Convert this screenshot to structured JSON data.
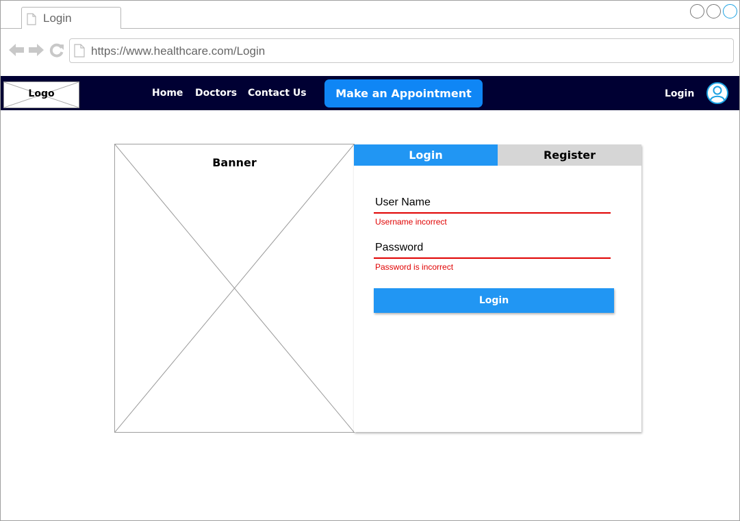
{
  "browser": {
    "tab_title": "Login",
    "url": "https://www.healthcare.com/Login"
  },
  "site_nav": {
    "logo": "Logo",
    "links": [
      "Home",
      "Doctors",
      "Contact Us"
    ],
    "appointment_button": "Make an Appointment",
    "login_link": "Login",
    "bg_color": "#000033",
    "accent_color": "#0f86f5"
  },
  "banner": {
    "label": "Banner"
  },
  "auth": {
    "tabs": [
      "Login",
      "Register"
    ],
    "active_tab": "Login",
    "username_label": "User Name",
    "username_error": "Username incorrect",
    "password_label": "Password",
    "password_error": "Password is incorrect",
    "submit_label": "Login",
    "error_color": "#e00000",
    "primary_color": "#2196f3"
  }
}
